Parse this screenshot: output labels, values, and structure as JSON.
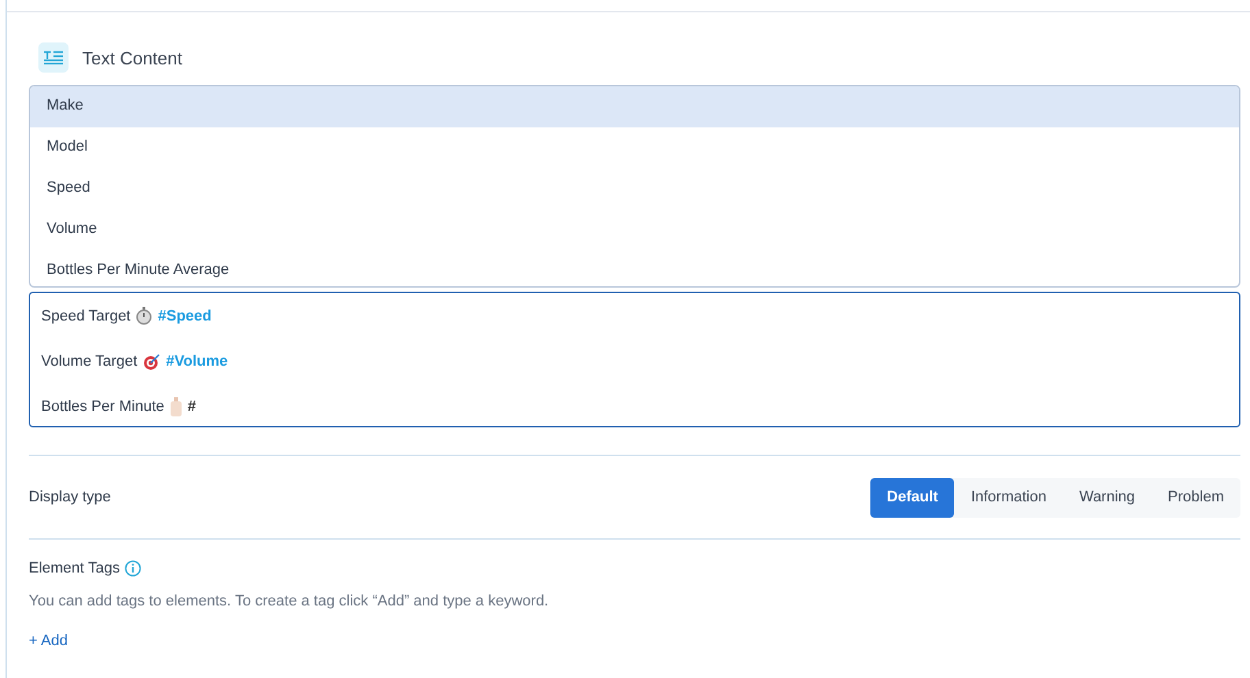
{
  "section": {
    "title": "Text Content"
  },
  "dropdown": {
    "options": [
      {
        "label": "Make",
        "selected": true
      },
      {
        "label": "Model",
        "selected": false
      },
      {
        "label": "Speed",
        "selected": false
      },
      {
        "label": "Volume",
        "selected": false
      },
      {
        "label": "Bottles Per Minute Average",
        "selected": false
      }
    ]
  },
  "editor": {
    "lines": [
      {
        "label": "Speed Target",
        "tag": "#Speed",
        "linked": true
      },
      {
        "label": "Volume Target",
        "tag": "#Volume",
        "linked": true
      },
      {
        "label": "Bottles Per Minute",
        "tag": "#",
        "linked": false
      }
    ]
  },
  "display_type": {
    "label": "Display type",
    "options": [
      {
        "label": "Default",
        "selected": true
      },
      {
        "label": "Information",
        "selected": false
      },
      {
        "label": "Warning",
        "selected": false
      },
      {
        "label": "Problem",
        "selected": false
      }
    ]
  },
  "element_tags": {
    "label": "Element Tags",
    "description": "You can add tags to elements. To create a tag click “Add” and type a keyword.",
    "add_link": "+ Add"
  }
}
